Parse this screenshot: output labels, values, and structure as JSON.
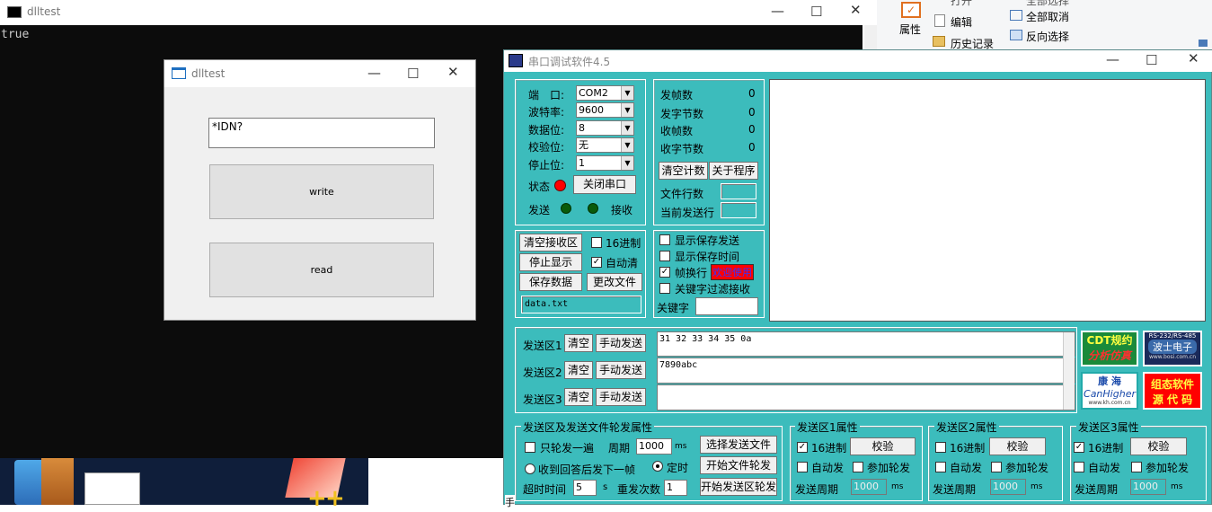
{
  "console": {
    "title": "dlltest",
    "output": "true"
  },
  "dlltest": {
    "title": "dlltest",
    "input_value": "*IDN?",
    "write_label": "write",
    "read_label": "read"
  },
  "ribbon": {
    "properties_label": "属性",
    "open_label": "打开",
    "edit_label": "编辑",
    "history_label": "历史记录",
    "select_all_label": "全部选择",
    "deselect_all_label": "全部取消",
    "invert_label": "反向选择"
  },
  "serial": {
    "title": "串口调试软件4.5",
    "port": {
      "port_label": "端　口:",
      "port_value": "COM2",
      "baud_label": "波特率:",
      "baud_value": "9600",
      "data_label": "数据位:",
      "data_value": "8",
      "parity_label": "校验位:",
      "parity_value": "无",
      "stop_label": "停止位:",
      "stop_value": "1",
      "status_label": "状态",
      "close_label": "关闭串口",
      "send_label": "发送",
      "recv_label": "接收"
    },
    "counts": {
      "sent_frames_label": "发帧数",
      "sent_frames": "0",
      "sent_bytes_label": "发字节数",
      "sent_bytes": "0",
      "recv_frames_label": "收帧数",
      "recv_frames": "0",
      "recv_bytes_label": "收字节数",
      "recv_bytes": "0",
      "clear_count_label": "清空计数",
      "about_label": "关于程序",
      "file_lines_label": "文件行数",
      "current_line_label": "当前发送行"
    },
    "recv_ctrl": {
      "clear_recv_label": "清空接收区",
      "hex_label": "16进制",
      "stop_display_label": "停止显示",
      "auto_clear_label": "自动清",
      "save_data_label": "保存数据",
      "change_file_label": "更改文件",
      "filename": "data.txt"
    },
    "display_opts": {
      "show_save_send": "显示保存发送",
      "show_save_time": "显示保存时间",
      "frame_wrap": "帧换行",
      "welcome": "欢迎使用",
      "keyword_filter": "关键字过滤接收",
      "keyword_label": "关键字"
    },
    "send_areas": [
      {
        "label": "发送区1",
        "clear": "清空",
        "manual": "手动发送",
        "content": "31 32 33 34 35 0a"
      },
      {
        "label": "发送区2",
        "clear": "清空",
        "manual": "手动发送",
        "content": "7890abc"
      },
      {
        "label": "发送区3",
        "clear": "清空",
        "manual": "手动发送",
        "content": ""
      }
    ],
    "ads": {
      "cdt_line1": "CDT规约",
      "cdt_line2": "分析仿真",
      "rs_top": "RS-232/RS-485",
      "rs_mid": "波士电子",
      "rs_url": "www.bosi.com.cn",
      "kh_line1": "康 海",
      "kh_line2": "CanHigher",
      "kh_url": "www.kh.com.cn",
      "zt_line1": "组态软件",
      "zt_line2": "源 代 码"
    },
    "rotate": {
      "title": "发送区及发送文件轮发属性",
      "only_once": "只轮发一遍",
      "period_label": "周期",
      "period_value": "1000",
      "ms": "ms",
      "select_file": "选择发送文件",
      "after_reply": "收到回答后发下一帧",
      "timed": "定时",
      "start_file": "开始文件轮发",
      "timeout_label": "超时时间",
      "timeout_value": "5",
      "s": "s",
      "resend_label": "重发次数",
      "resend_value": "1",
      "start_area": "开始发送区轮发"
    },
    "area_props": [
      {
        "title": "发送区1属性",
        "hex": "16进制",
        "check": "校验",
        "auto": "自动发",
        "join": "参加轮发",
        "period_label": "发送周期",
        "period_value": "1000",
        "ms": "ms"
      },
      {
        "title": "发送区2属性",
        "hex": "16进制",
        "check": "校验",
        "auto": "自动发",
        "join": "参加轮发",
        "period_label": "发送周期",
        "period_value": "1000",
        "ms": "ms"
      },
      {
        "title": "发送区3属性",
        "hex": "16进制",
        "check": "校验",
        "auto": "自动发",
        "join": "参加轮发",
        "period_label": "发送周期",
        "period_value": "1000",
        "ms": "ms"
      }
    ]
  },
  "taskbar": {
    "corner_glyph": "手"
  },
  "colors": {
    "serial_bg": "#3cbcbc",
    "console_bg": "#0c0c0c",
    "led_red": "#ff0000",
    "led_green": "#0a5a0a",
    "welcome_bg": "#ff0000"
  }
}
